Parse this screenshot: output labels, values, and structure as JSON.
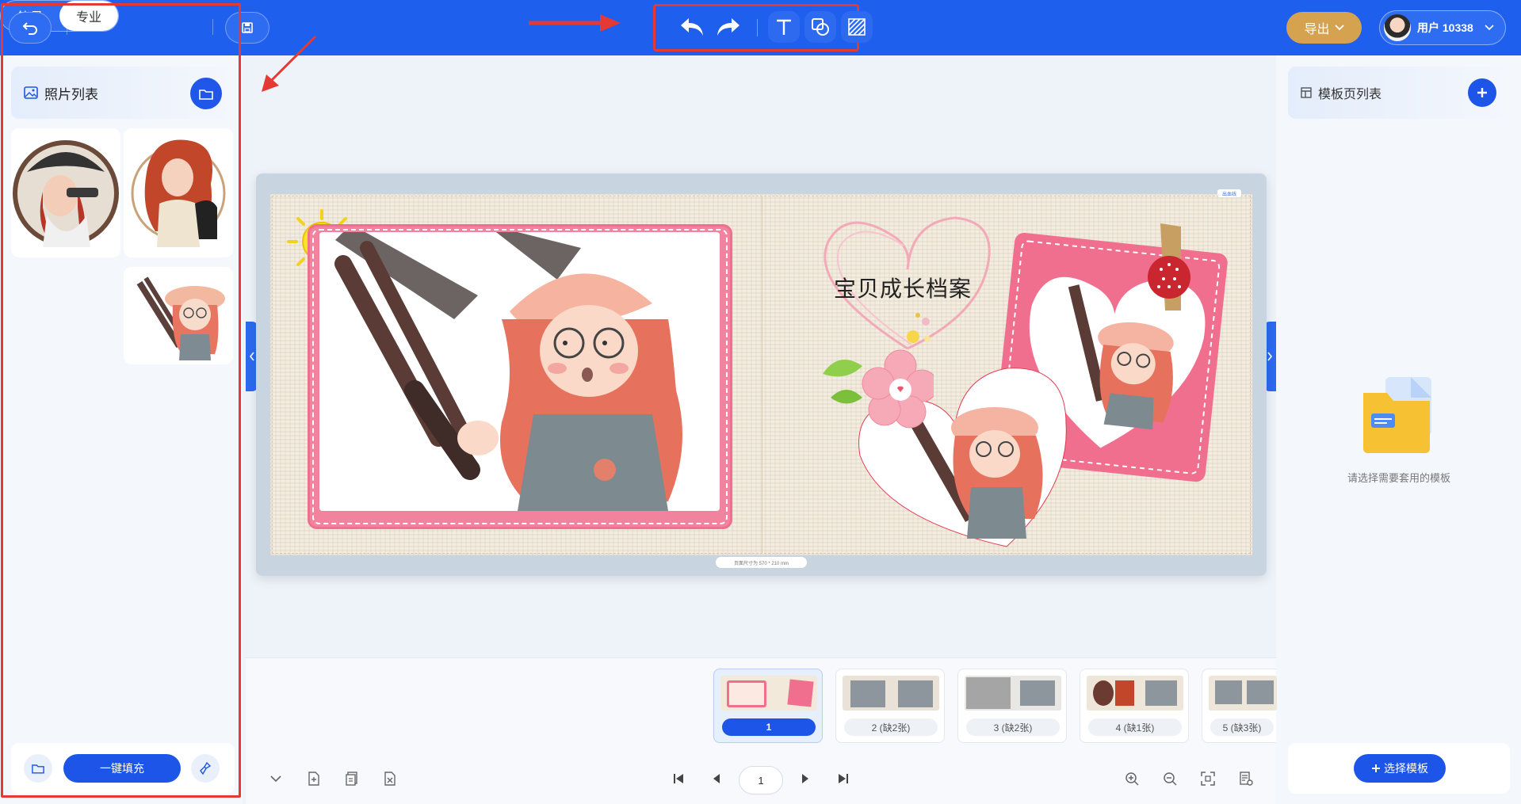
{
  "topbar": {
    "mode_simple": "简易",
    "mode_pro": "专业",
    "export_label": "导出",
    "user_label": "用户 10338",
    "tools": [
      "undo-icon",
      "redo-icon",
      "text-tool-icon",
      "shape-tool-icon",
      "texture-tool-icon"
    ],
    "accent_color": "#1f5fee"
  },
  "left_panel": {
    "title": "照片列表",
    "photos": [
      "pirate-girl-photo",
      "redhead-with-cat-photo",
      "girl-with-gun-photo"
    ],
    "fill_button": "一键填充"
  },
  "canvas": {
    "title_text": "宝贝成长档案",
    "page_size_label": "页面尺寸为 570 * 210 mm",
    "corner_tag": "出血线"
  },
  "right_panel": {
    "title": "模板页列表",
    "empty_hint": "请选择需要套用的模板",
    "select_button": "选择模板"
  },
  "pages": [
    {
      "label": "1",
      "active": true
    },
    {
      "label": "2 (缺2张)",
      "active": false
    },
    {
      "label": "3 (缺2张)",
      "active": false
    },
    {
      "label": "4 (缺1张)",
      "active": false
    },
    {
      "label": "5 (缺3张)",
      "active": false
    }
  ],
  "pagination": {
    "current_page": "1"
  }
}
